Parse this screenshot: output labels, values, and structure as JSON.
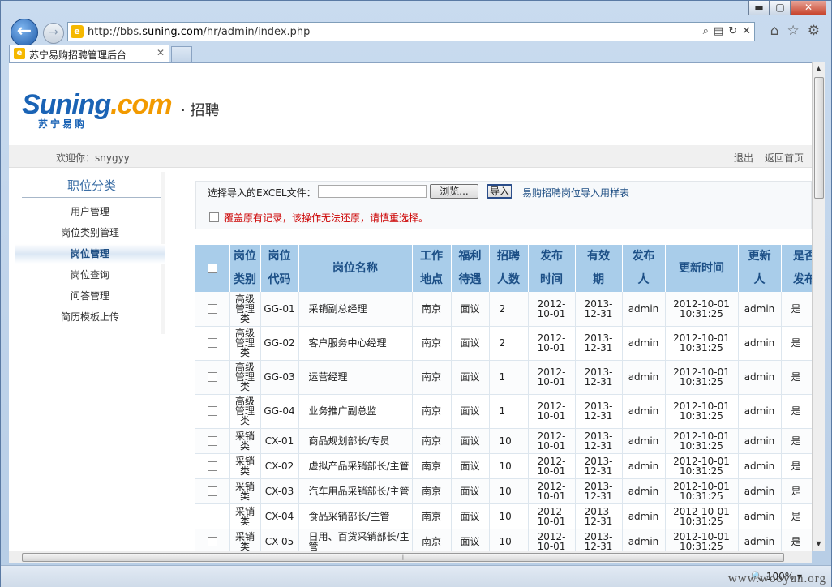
{
  "browser": {
    "window_buttons": {
      "minimize": "▬",
      "maximize": "▢",
      "close": "✕"
    },
    "address": {
      "url_prefix": "http://bbs.",
      "url_domain": "suning.com",
      "url_path": "/hr/admin/index.php"
    },
    "tab_title": "苏宁易购招聘管理后台",
    "zoom": "100%",
    "watermark": "www.wooyun.org"
  },
  "header": {
    "logo_part1": "Suning",
    "logo_part2": ".com",
    "logo_sub": "苏宁易购",
    "section": "· 招聘",
    "welcome": "欢迎你：snygyy",
    "logout": "退出",
    "home": "返回首页"
  },
  "sidebar": {
    "title": "职位分类",
    "items": [
      {
        "label": "用户管理"
      },
      {
        "label": "岗位类别管理"
      },
      {
        "label": "岗位管理"
      },
      {
        "label": "岗位查询"
      },
      {
        "label": "问答管理"
      },
      {
        "label": "简历模板上传"
      }
    ],
    "active": 2
  },
  "import_panel": {
    "label": "选择导入的EXCEL文件：",
    "browse": "浏览...",
    "submit": "导入",
    "template_link": "易购招聘岗位导入用样表",
    "overwrite_warning": "覆盖原有记录，该操作无法还原，请慎重选择。"
  },
  "table": {
    "headers": {
      "category": "岗位\n类别",
      "code": "岗位\n代码",
      "name": "岗位名称",
      "location": "工作\n地点",
      "welfare": "福利\n待遇",
      "count": "招聘\n人数",
      "published": "发布\n时间",
      "valid": "有效\n期",
      "publisher": "发布\n人",
      "updated": "更新时间",
      "updater": "更新\n人",
      "is_published": "是否\n发布"
    },
    "rows": [
      {
        "category": "高级管理类",
        "code": "GG-01",
        "name": "采销副总经理",
        "location": "南京",
        "welfare": "面议",
        "count": "2",
        "published": "2012-10-01",
        "valid": "2013-12-31",
        "publisher": "admin",
        "updated": "2012-10-01 10:31:25",
        "updater": "admin",
        "is_published": "是"
      },
      {
        "category": "高级管理类",
        "code": "GG-02",
        "name": "客户服务中心经理",
        "location": "南京",
        "welfare": "面议",
        "count": "2",
        "published": "2012-10-01",
        "valid": "2013-12-31",
        "publisher": "admin",
        "updated": "2012-10-01 10:31:25",
        "updater": "admin",
        "is_published": "是"
      },
      {
        "category": "高级管理类",
        "code": "GG-03",
        "name": "运营经理",
        "location": "南京",
        "welfare": "面议",
        "count": "1",
        "published": "2012-10-01",
        "valid": "2013-12-31",
        "publisher": "admin",
        "updated": "2012-10-01 10:31:25",
        "updater": "admin",
        "is_published": "是"
      },
      {
        "category": "高级管理类",
        "code": "GG-04",
        "name": "业务推广副总监",
        "location": "南京",
        "welfare": "面议",
        "count": "1",
        "published": "2012-10-01",
        "valid": "2013-12-31",
        "publisher": "admin",
        "updated": "2012-10-01 10:31:25",
        "updater": "admin",
        "is_published": "是"
      },
      {
        "category": "采销类",
        "code": "CX-01",
        "name": "商品规划部长/专员",
        "location": "南京",
        "welfare": "面议",
        "count": "10",
        "published": "2012-10-01",
        "valid": "2013-12-31",
        "publisher": "admin",
        "updated": "2012-10-01 10:31:25",
        "updater": "admin",
        "is_published": "是"
      },
      {
        "category": "采销类",
        "code": "CX-02",
        "name": "虚拟产品采销部长/主管",
        "location": "南京",
        "welfare": "面议",
        "count": "10",
        "published": "2012-10-01",
        "valid": "2013-12-31",
        "publisher": "admin",
        "updated": "2012-10-01 10:31:25",
        "updater": "admin",
        "is_published": "是"
      },
      {
        "category": "采销类",
        "code": "CX-03",
        "name": "汽车用品采销部长/主管",
        "location": "南京",
        "welfare": "面议",
        "count": "10",
        "published": "2012-10-01",
        "valid": "2013-12-31",
        "publisher": "admin",
        "updated": "2012-10-01 10:31:25",
        "updater": "admin",
        "is_published": "是"
      },
      {
        "category": "采销类",
        "code": "CX-04",
        "name": "食品采销部长/主管",
        "location": "南京",
        "welfare": "面议",
        "count": "10",
        "published": "2012-10-01",
        "valid": "2013-12-31",
        "publisher": "admin",
        "updated": "2012-10-01 10:31:25",
        "updater": "admin",
        "is_published": "是"
      },
      {
        "category": "采销类",
        "code": "CX-05",
        "name": "日用、百货采销部长/主管",
        "location": "南京",
        "welfare": "面议",
        "count": "10",
        "published": "2012-10-01",
        "valid": "2013-12-31",
        "publisher": "admin",
        "updated": "2012-10-01 10:31:25",
        "updater": "admin",
        "is_published": "是"
      }
    ]
  }
}
